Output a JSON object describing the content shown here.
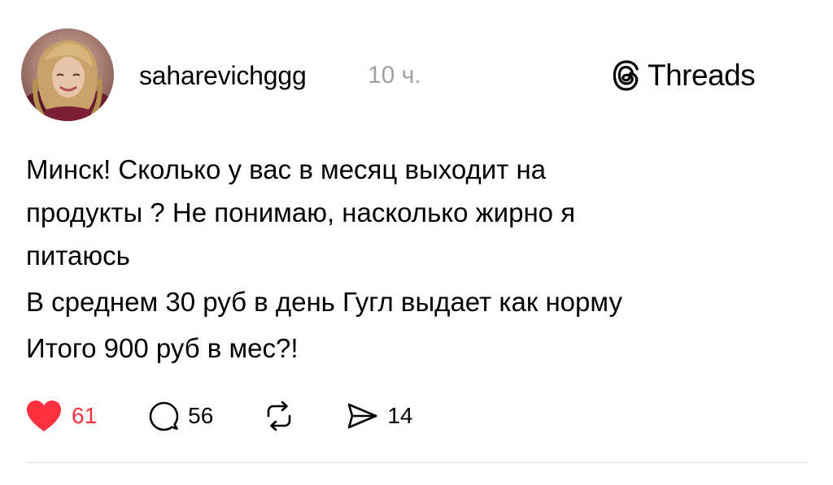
{
  "post": {
    "author": {
      "username": "saharevichggg"
    },
    "timestamp": "10 ч.",
    "brand": {
      "name": "Threads",
      "logo_icon": "threads-logo-icon"
    },
    "text_lines": [
      "Минск! Сколько у вас в месяц выходит на",
      "продукты ? Не понимаю, насколько жирно я",
      "питаюсь",
      "В среднем 30 руб в день Гугл выдает как норму",
      "Итого 900 руб в мес?!"
    ],
    "actions": {
      "like": {
        "icon": "heart-icon",
        "count": "61",
        "active": true,
        "color": "#ff3040"
      },
      "comment": {
        "icon": "speech-bubble-icon",
        "count": "56"
      },
      "repost": {
        "icon": "repost-icon"
      },
      "share": {
        "icon": "send-icon",
        "count": "14"
      }
    }
  },
  "colors": {
    "text": "#000000",
    "timestamp": "#a0a0a0",
    "like_active": "#ff3040",
    "divider": "#e4e4e4"
  }
}
